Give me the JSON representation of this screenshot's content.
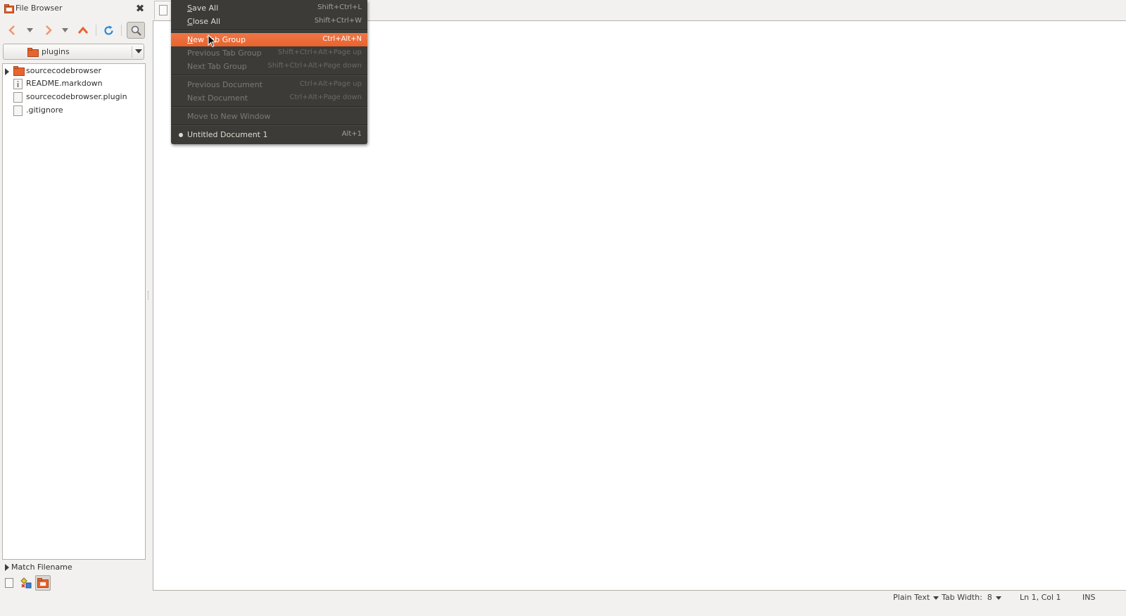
{
  "side_panel": {
    "title": "File Browser",
    "location": "plugins",
    "tree": [
      {
        "label": "sourcecodebrowser",
        "type": "folder",
        "expandable": true
      },
      {
        "label": "README.markdown",
        "type": "text-file",
        "expandable": false
      },
      {
        "label": "sourcecodebrowser.plugin",
        "type": "file",
        "expandable": false
      },
      {
        "label": ".gitignore",
        "type": "file",
        "expandable": false
      }
    ],
    "match_filename": "Match Filename"
  },
  "menu": {
    "items": [
      {
        "label_ul": "S",
        "label_rest": "ave All",
        "shortcut": "Shift+Ctrl+L",
        "enabled": true
      },
      {
        "label_ul": "C",
        "label_rest": "lose All",
        "shortcut": "Shift+Ctrl+W",
        "enabled": true
      },
      {
        "label_ul": "N",
        "label_rest": "ew Tab Group",
        "shortcut": "Ctrl+Alt+N",
        "enabled": true,
        "highlighted": true
      },
      {
        "label": "Previous Tab Group",
        "shortcut": "Shift+Ctrl+Alt+Page up",
        "enabled": false
      },
      {
        "label": "Next Tab Group",
        "shortcut": "Shift+Ctrl+Alt+Page down",
        "enabled": false
      },
      {
        "label": "Previous Document",
        "shortcut": "Ctrl+Alt+Page up",
        "enabled": false
      },
      {
        "label": "Next Document",
        "shortcut": "Ctrl+Alt+Page down",
        "enabled": false
      },
      {
        "label": "Move to New Window",
        "shortcut": "",
        "enabled": false
      },
      {
        "label": "Untitled Document 1",
        "shortcut": "Alt+1",
        "enabled": true,
        "radio_selected": true
      }
    ]
  },
  "status_bar": {
    "language": "Plain Text",
    "tab_width": "Tab Width:  8",
    "position": "Ln 1, Col 1",
    "mode": "INS"
  },
  "colors": {
    "accent": "#f07746",
    "menu_bg": "#3c3b37",
    "panel_bg": "#f2f1f0",
    "folder": "#e8642f"
  },
  "icons": [
    "app-icon",
    "close-icon",
    "back-arrow-icon",
    "forward-arrow-icon",
    "up-arrow-icon",
    "refresh-icon",
    "filter-icon",
    "folder-icon",
    "file-icon",
    "document-tab-icon",
    "mouse-cursor-icon"
  ]
}
